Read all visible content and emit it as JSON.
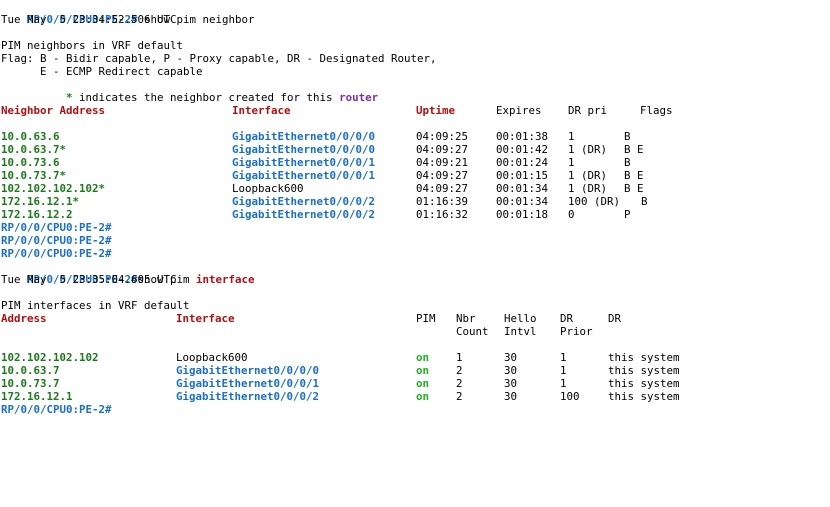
{
  "prompt": "RP/0/0/CPU0:PE-2#",
  "cmd1": {
    "text": " show pim neighbor",
    "timestamp": "Tue May  5 23:34:52.506 UTC"
  },
  "legend": {
    "vrf_line": "PIM neighbors in VRF default",
    "flag_line1": "Flag: B - Bidir capable, P - Proxy capable, DR - Designated Router,",
    "flag_line2": "      E - ECMP Redirect capable",
    "star": "*",
    "star_text_before": " indicates the neighbor created for this ",
    "star_text_word": "router"
  },
  "neighbor_table": {
    "headers": {
      "address": "Neighbor Address",
      "interface": "Interface",
      "uptime": "Uptime",
      "expires": "Expires",
      "drpri": "DR pri",
      "flags": "Flags"
    },
    "rows": [
      {
        "address": "10.0.63.6",
        "interface": "GigabitEthernet0/0/0/0",
        "uptime": "04:09:25",
        "expires": "00:01:38",
        "drpri": "1",
        "flags": "B"
      },
      {
        "address": "10.0.63.7*",
        "interface": "GigabitEthernet0/0/0/0",
        "uptime": "04:09:27",
        "expires": "00:01:42",
        "drpri": "1 (DR)",
        "flags": "B E"
      },
      {
        "address": "10.0.73.6",
        "interface": "GigabitEthernet0/0/0/1",
        "uptime": "04:09:21",
        "expires": "00:01:24",
        "drpri": "1",
        "flags": "B"
      },
      {
        "address": "10.0.73.7*",
        "interface": "GigabitEthernet0/0/0/1",
        "uptime": "04:09:27",
        "expires": "00:01:15",
        "drpri": "1 (DR)",
        "flags": "B E"
      },
      {
        "address": "102.102.102.102*",
        "interface": "Loopback600",
        "uptime": "04:09:27",
        "expires": "00:01:34",
        "drpri": "1 (DR)",
        "flags": "B E"
      },
      {
        "address": "172.16.12.1*",
        "interface": "GigabitEthernet0/0/0/2",
        "uptime": "01:16:39",
        "expires": "00:01:34",
        "drpri": "100 (DR)",
        "flags": "B"
      },
      {
        "address": "172.16.12.2",
        "interface": "GigabitEthernet0/0/0/2",
        "uptime": "01:16:32",
        "expires": "00:01:18",
        "drpri": "0",
        "flags": "P"
      }
    ]
  },
  "cmd2": {
    "text_before": "show pim ",
    "keyword": "interface",
    "timestamp": "Tue May  5 23:35:04.605 UTC"
  },
  "interface_vrf_line": "PIM interfaces in VRF default",
  "interface_table": {
    "headers": {
      "address": "Address",
      "interface": "Interface",
      "pim": "PIM",
      "nbr1": "Nbr",
      "nbr2": "Count",
      "hello1": "Hello",
      "hello2": "Intvl",
      "dr1": "DR",
      "dr2": "Prior",
      "drcol": "DR"
    },
    "rows": [
      {
        "address": "102.102.102.102",
        "interface": "Loopback600",
        "pim": "on",
        "count": "1",
        "intvl": "30",
        "prior": "1",
        "dr": "this system"
      },
      {
        "address": "10.0.63.7",
        "interface": "GigabitEthernet0/0/0/0",
        "pim": "on",
        "count": "2",
        "intvl": "30",
        "prior": "1",
        "dr": "this system"
      },
      {
        "address": "10.0.73.7",
        "interface": "GigabitEthernet0/0/0/1",
        "pim": "on",
        "count": "2",
        "intvl": "30",
        "prior": "1",
        "dr": "this system"
      },
      {
        "address": "172.16.12.1",
        "interface": "GigabitEthernet0/0/0/2",
        "pim": "on",
        "count": "2",
        "intvl": "30",
        "prior": "100",
        "dr": "this system"
      }
    ]
  },
  "colors": {
    "prompt": "#1a6fc9",
    "header": "#b01010",
    "address": "#1e7a1e",
    "interface_link": "#1a6fc9",
    "keyword": "#7b2fa6",
    "status_on": "#22b022"
  }
}
